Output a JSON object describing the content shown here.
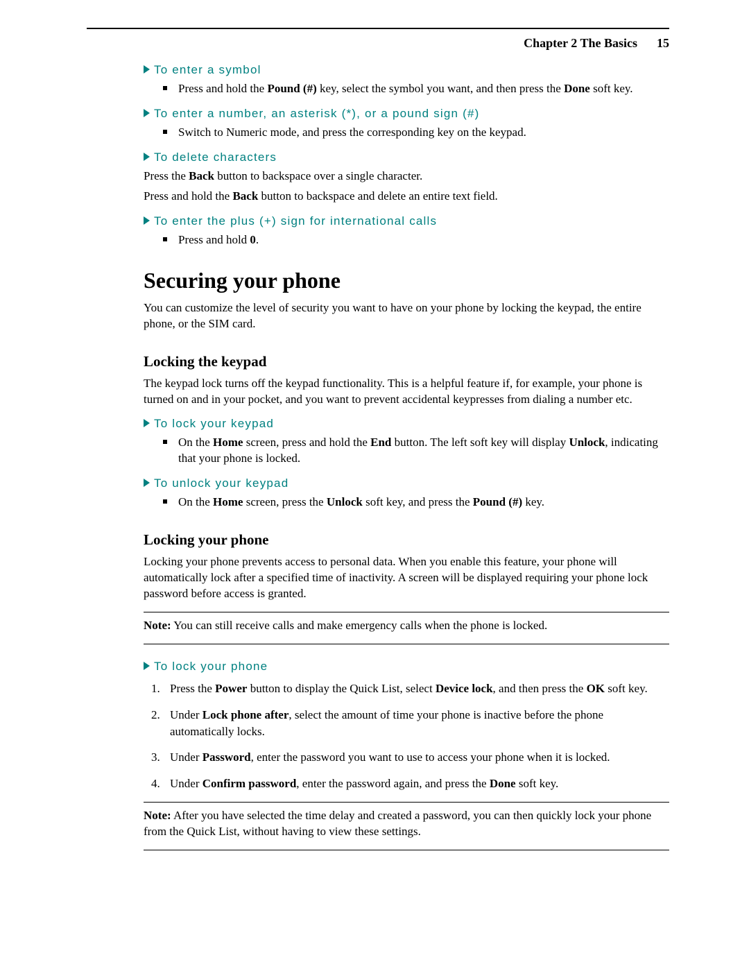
{
  "header": {
    "chapter": "Chapter 2 The Basics",
    "page": "15"
  },
  "sections": {
    "enter_symbol": {
      "title": "To enter a symbol",
      "bullet_pre": "Press and hold the ",
      "bullet_b1": "Pound (#)",
      "bullet_mid": " key, select the symbol you want, and then press the ",
      "bullet_b2": "Done",
      "bullet_post": " soft key."
    },
    "enter_number": {
      "title": "To enter a number, an asterisk (*), or a pound sign (#)",
      "bullet": "Switch to Numeric mode, and press the corresponding key on the keypad."
    },
    "delete_chars": {
      "title": "To delete characters",
      "p1_pre": "Press the ",
      "p1_b": "Back",
      "p1_post": " button to backspace over a single character.",
      "p2_pre": "Press and hold the ",
      "p2_b": "Back",
      "p2_post": " button to backspace and delete an entire text field."
    },
    "enter_plus": {
      "title": "To enter the plus (+) sign for international calls",
      "bullet_pre": "Press and hold ",
      "bullet_b": "0",
      "bullet_post": "."
    },
    "securing": {
      "title": "Securing your phone",
      "intro": "You can customize the level of security you want to have on your phone by locking the keypad, the entire phone, or the SIM card."
    },
    "locking_keypad": {
      "title": "Locking the keypad",
      "intro": "The keypad lock turns off the keypad functionality. This is a helpful feature if, for example, your phone is turned on and in your pocket, and you want to prevent accidental keypresses from dialing a number etc."
    },
    "lock_keypad": {
      "title": "To lock your keypad",
      "bullet_t1": "On the ",
      "bullet_b1": "Home",
      "bullet_t2": " screen, press and hold the ",
      "bullet_b2": "End",
      "bullet_t3": " button. The left soft key will display ",
      "bullet_b3": "Unlock",
      "bullet_t4": ", indicating that your phone is locked."
    },
    "unlock_keypad": {
      "title": "To unlock your keypad",
      "bullet_t1": "On the ",
      "bullet_b1": "Home",
      "bullet_t2": " screen, press the ",
      "bullet_b2": "Unlock",
      "bullet_t3": " soft key, and press the ",
      "bullet_b3": "Pound (#)",
      "bullet_t4": " key."
    },
    "locking_phone": {
      "title": "Locking your phone",
      "intro": "Locking your phone prevents access to personal data. When you enable this feature, your phone will automatically lock after a specified time of inactivity. A screen will be displayed requiring your phone lock password before access is granted.",
      "note_label": "Note:",
      "note_text": " You can still receive calls and make emergency calls when the phone is locked."
    },
    "lock_phone": {
      "title": "To lock your phone",
      "step1_t1": "Press the ",
      "step1_b1": "Power",
      "step1_t2": " button to display the Quick List, select ",
      "step1_b2": "Device lock",
      "step1_t3": ", and then press the ",
      "step1_b3": "OK",
      "step1_t4": " soft key.",
      "step2_t1": "Under ",
      "step2_b1": "Lock phone after",
      "step2_t2": ", select the amount of time your phone is inactive before the phone automatically locks.",
      "step3_t1": "Under ",
      "step3_b1": "Password",
      "step3_t2": ", enter the password you want to use to access your phone when it is locked.",
      "step4_t1": "Under ",
      "step4_b1": "Confirm password",
      "step4_t2": ", enter the password again, and press the ",
      "step4_b2": "Done",
      "step4_t3": " soft key.",
      "note2_label": "Note:",
      "note2_text": " After you have selected the time delay and created a password, you can then quickly lock your phone from the Quick List, without having to view these settings."
    }
  }
}
